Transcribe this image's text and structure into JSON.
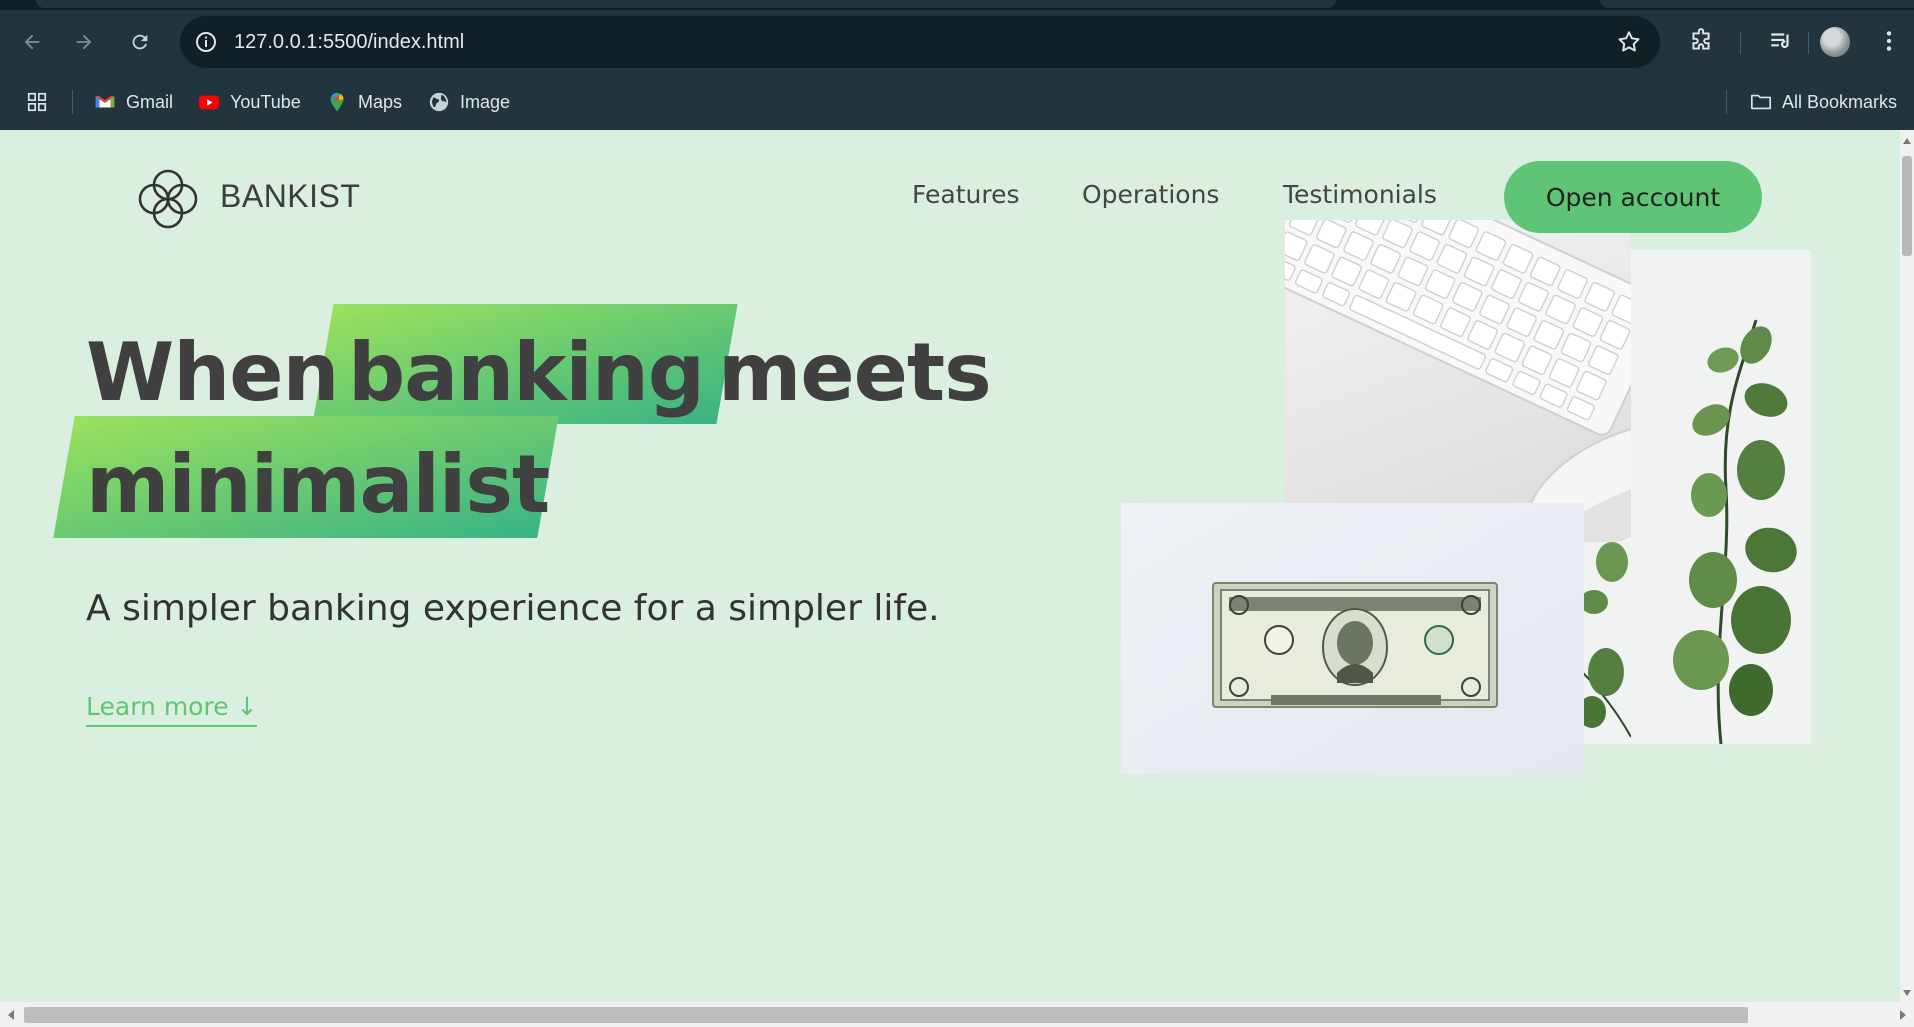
{
  "browser": {
    "url": "127.0.0.1:5500/index.html",
    "bookmarks": [
      {
        "label": "Gmail",
        "icon": "gmail-icon"
      },
      {
        "label": "YouTube",
        "icon": "youtube-icon"
      },
      {
        "label": "Maps",
        "icon": "maps-icon"
      },
      {
        "label": "Image",
        "icon": "globe-icon"
      }
    ],
    "all_bookmarks_label": "All Bookmarks"
  },
  "page": {
    "brand": "BANKIST",
    "nav": {
      "features": "Features",
      "operations": "Operations",
      "testimonials": "Testimonials",
      "cta": "Open account"
    },
    "hero": {
      "word_when": "When",
      "word_banking": "banking",
      "word_meets": "meets",
      "word_minimalist": "minimalist",
      "subtitle": "A simpler banking experience for a simpler life.",
      "learn_more": "Learn more ↓"
    }
  },
  "colors": {
    "page_bg": "#daefdf",
    "primary": "#5ec576",
    "highlight_from": "#9be15d",
    "highlight_to": "#39b385",
    "text_dark": "#404040"
  }
}
